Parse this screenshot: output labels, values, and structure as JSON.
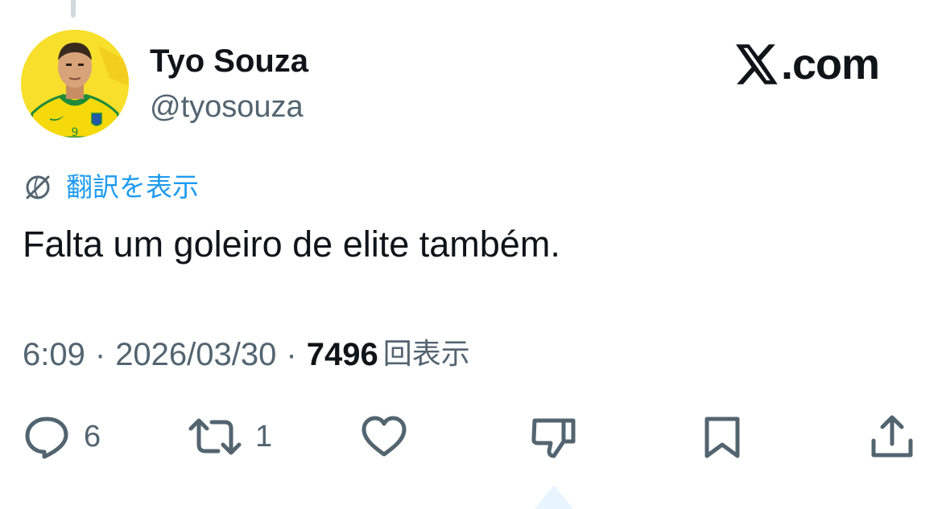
{
  "author": {
    "display_name": "Tyo Souza",
    "handle": "@tyosouza",
    "avatar_icon": "player-avatar"
  },
  "brand": {
    "icon": "x-logo-icon",
    "text": ".com"
  },
  "translate": {
    "icon": "translate-globe-icon",
    "label": "翻訳を表示"
  },
  "tweet": {
    "text": "Falta um goleiro de elite também."
  },
  "meta": {
    "time": "6:09",
    "separator": "·",
    "date": "2026/03/30",
    "views_count": "7496",
    "views_label": "回表示"
  },
  "actions": {
    "reply": {
      "icon": "reply-icon",
      "count": "6"
    },
    "repost": {
      "icon": "repost-icon",
      "count": "1"
    },
    "like": {
      "icon": "heart-icon"
    },
    "dislike": {
      "icon": "dislike-icon"
    },
    "bookmark": {
      "icon": "bookmark-icon"
    },
    "share": {
      "icon": "share-icon"
    }
  },
  "colors": {
    "text_primary": "#0f1419",
    "text_secondary": "#536471",
    "link_blue": "#1d9bf0",
    "avatar_yellow": "#f7df2b",
    "jersey_green": "#1f8a3a"
  }
}
